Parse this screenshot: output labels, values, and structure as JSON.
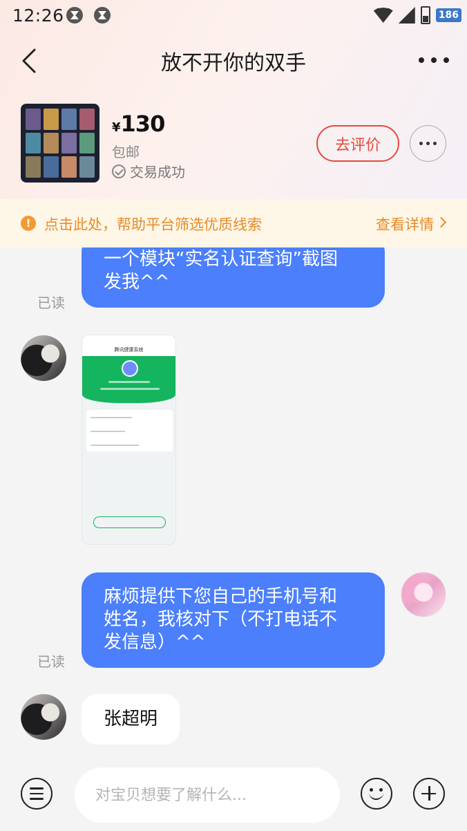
{
  "status_bar": {
    "time": "12:26",
    "network_badge": "186"
  },
  "header": {
    "title": "放不开你的双手"
  },
  "product": {
    "currency": "¥",
    "price": "130",
    "shipping": "包邮",
    "status": "交易成功",
    "review_label": "去评价"
  },
  "notice": {
    "text": "点击此处，帮助平台筛选优质线索",
    "link": "查看详情"
  },
  "messages": [
    {
      "lines": [
        "一个模块“实名认证查询”截图",
        "发我^^"
      ],
      "read": "已读"
    },
    {
      "screenshot_title": "腾讯健康系统"
    },
    {
      "lines": [
        "麻烦提供下您自己的手机号和",
        "姓名，我核对下（不打电话不",
        "发信息）^^"
      ],
      "read": "已读"
    },
    {
      "text": "张超明"
    }
  ],
  "input": {
    "placeholder": "对宝贝想要了解什么..."
  },
  "colors": {
    "accent_blue": "#4b7ffb",
    "review_red": "#e24a3c",
    "notice_orange": "#e58c2a",
    "notice_bg": "#fef6e6"
  }
}
